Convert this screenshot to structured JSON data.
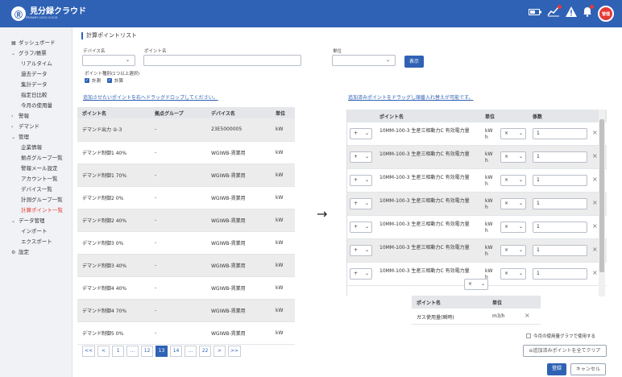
{
  "brand": {
    "logo_mark": "Ⓡ",
    "name": "見分録クラウド",
    "sub": "PRIMARY LOGS CLOUD"
  },
  "header_icons": [
    "battery-icon",
    "chart-icon",
    "warning-icon",
    "bell-icon"
  ],
  "user_badge": "管理",
  "sidebar": [
    {
      "icon": "▦",
      "label": "ダッシュボード",
      "sub": false
    },
    {
      "icon": "⌄",
      "label": "グラフ/帳票",
      "sub": false
    },
    {
      "icon": "",
      "label": "リアルタイム",
      "sub": true
    },
    {
      "icon": "",
      "label": "過去データ",
      "sub": true
    },
    {
      "icon": "",
      "label": "集計データ",
      "sub": true
    },
    {
      "icon": "",
      "label": "指定日比較",
      "sub": true
    },
    {
      "icon": "",
      "label": "今月の使用量",
      "sub": true
    },
    {
      "icon": "›",
      "label": "警報",
      "sub": false
    },
    {
      "icon": "›",
      "label": "デマンド",
      "sub": false
    },
    {
      "icon": "⌄",
      "label": "管理",
      "sub": false
    },
    {
      "icon": "",
      "label": "企業情報",
      "sub": true
    },
    {
      "icon": "",
      "label": "拠点グループ一覧",
      "sub": true
    },
    {
      "icon": "",
      "label": "警報メール設定",
      "sub": true
    },
    {
      "icon": "",
      "label": "アカウント一覧",
      "sub": true
    },
    {
      "icon": "",
      "label": "デバイス一覧",
      "sub": true
    },
    {
      "icon": "",
      "label": "計測グループ一覧",
      "sub": true
    },
    {
      "icon": "",
      "label": "計算ポイント一覧",
      "sub": true,
      "active": true
    },
    {
      "icon": "⌄",
      "label": "データ管理",
      "sub": false
    },
    {
      "icon": "",
      "label": "インポート",
      "sub": true
    },
    {
      "icon": "",
      "label": "エクスポート",
      "sub": true
    },
    {
      "icon": "⚙",
      "label": "設定",
      "sub": false
    }
  ],
  "page_title": "計算ポイントリスト",
  "filters": {
    "device_label": "デバイス名",
    "point_label": "ポイント名",
    "unit_label": "単位",
    "show_button": "表示",
    "type_label": "ポイント種別(1つ以上選択)",
    "type_measure": "計測",
    "type_calc": "計算"
  },
  "left_hint": "追加させたいポイントを右へドラッグドロップしてください。",
  "right_hint": "追加済みポイントをドラッグし順番入れ替えが可能です。",
  "left_table": {
    "headers": [
      "ポイント名",
      "拠点グループ",
      "デバイス名",
      "単位"
    ],
    "rows": [
      [
        "デマンド出力 ②-3",
        "-",
        "23E5000005",
        "kW"
      ],
      [
        "デマンド制御1 40%",
        "-",
        "WGIWB-賃業用",
        "kW"
      ],
      [
        "デマンド制御1 70%",
        "-",
        "WGIWB-賃業用",
        "kW"
      ],
      [
        "デマンド制御2 0%",
        "-",
        "WGIWB-賃業用",
        "kW"
      ],
      [
        "デマンド制御2 40%",
        "-",
        "WGIWB-賃業用",
        "kW"
      ],
      [
        "デマンド制御3 0%",
        "-",
        "WGIWB-賃業用",
        "kW"
      ],
      [
        "デマンド制御3 40%",
        "-",
        "WGIWB-賃業用",
        "kW"
      ],
      [
        "デマンド制御4 40%",
        "-",
        "WGIWB-賃業用",
        "kW"
      ],
      [
        "デマンド制御4 70%",
        "-",
        "WGIWB-賃業用",
        "kW"
      ],
      [
        "デマンド制御5 0%",
        "-",
        "WGIWB-賃業用",
        "kW"
      ]
    ]
  },
  "right_table": {
    "headers": [
      "ポイント名",
      "単位",
      "係数"
    ],
    "rows": [
      {
        "op": "+",
        "name": "10MM-100-3 生産三相動力C 有効電力量",
        "unit": "kWh",
        "mul": "×",
        "coef": "1"
      },
      {
        "op": "+",
        "name": "10MM-100-3 生産三相動力C 有効電力量",
        "unit": "kWh",
        "mul": "×",
        "coef": "1"
      },
      {
        "op": "+",
        "name": "10MM-100-3 生産三相動力C 有効電力量",
        "unit": "kWh",
        "mul": "×",
        "coef": "1"
      },
      {
        "op": "+",
        "name": "10MM-100-3 生産三相動力C 有効電力量",
        "unit": "kWh",
        "mul": "×",
        "coef": "1"
      },
      {
        "op": "+",
        "name": "10MM-100-3 生産三相動力C 有効電力量",
        "unit": "kWh",
        "mul": "×",
        "coef": "1"
      },
      {
        "op": "+",
        "name": "10MM-100-3 生産三相動力C 有効電力量",
        "unit": "kWh",
        "mul": "×",
        "coef": "1"
      },
      {
        "op": "+",
        "name": "10MM-100-3 生産三相動力C 有効電力量",
        "unit": "kWh",
        "mul": "×",
        "coef": "1"
      }
    ]
  },
  "divider_op": "×",
  "result_table": {
    "headers": [
      "ポイント名",
      "単位"
    ],
    "row": [
      "ガス使用量(瞬時)",
      "m3/h"
    ]
  },
  "use_in_graph": "今月の使用量グラフで使用する",
  "clear_all": "追加済みポイントを全てクリア",
  "register": "登録",
  "cancel": "キャンセル",
  "pager": [
    "<<",
    "<",
    "1",
    "...",
    "12",
    "13",
    "14",
    "...",
    "22",
    ">",
    ">>"
  ],
  "pager_active": "13"
}
